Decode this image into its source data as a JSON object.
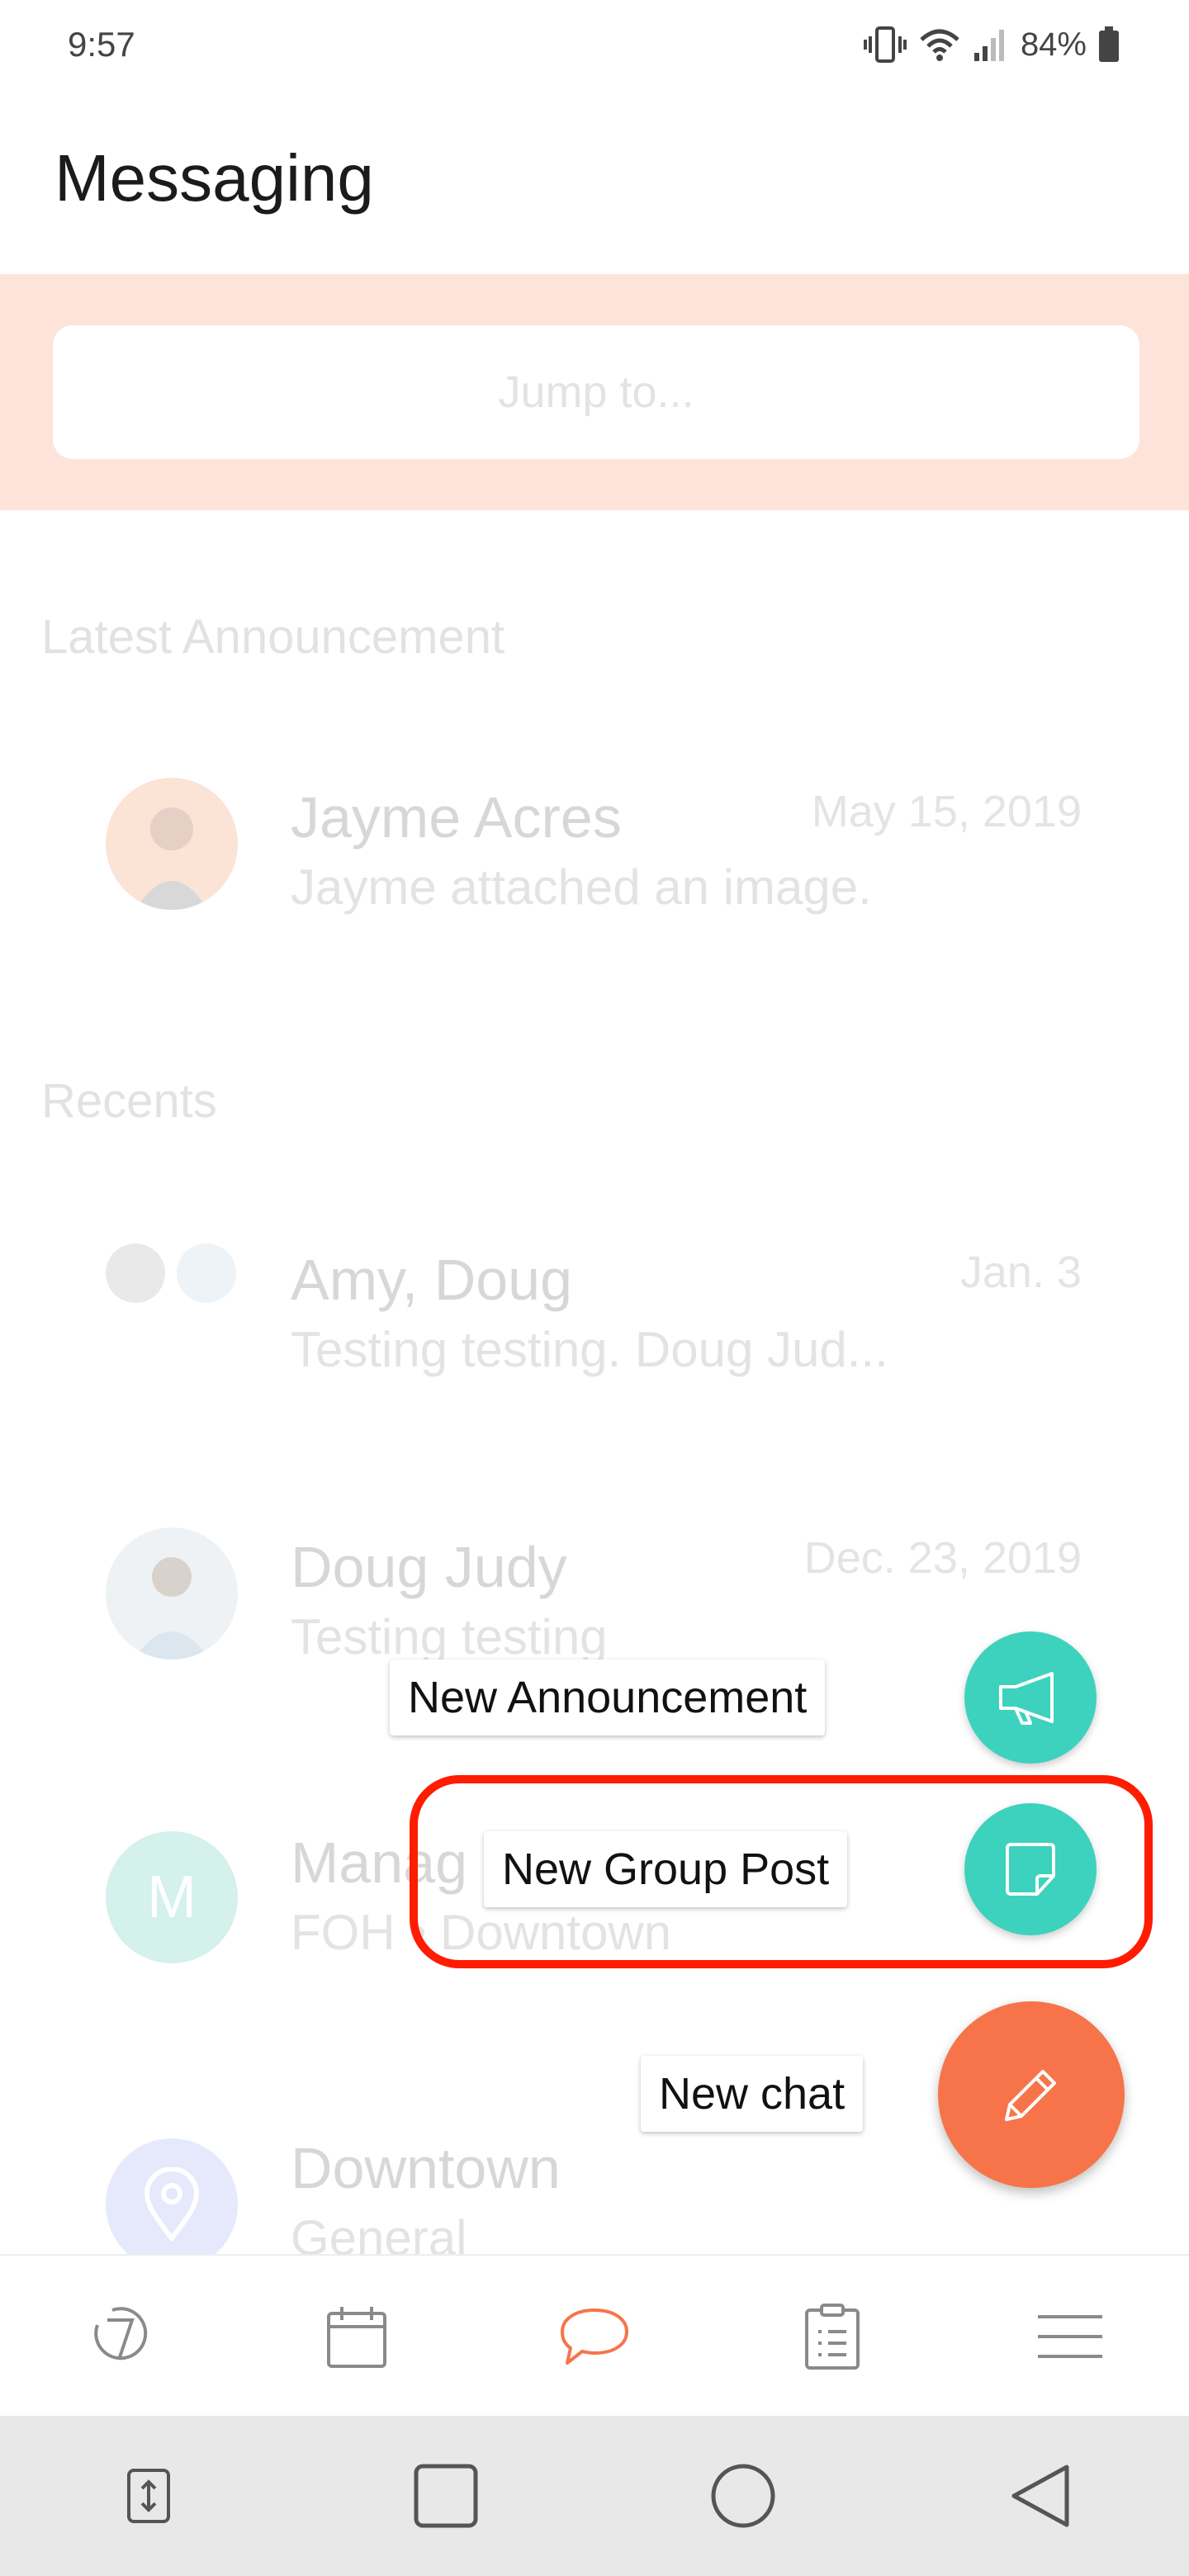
{
  "status_bar": {
    "time": "9:57",
    "battery": "84%"
  },
  "header": {
    "title": "Messaging"
  },
  "search": {
    "placeholder": "Jump to..."
  },
  "latest_announcement": {
    "label": "Latest Announcement",
    "item": {
      "name": "Jayme Acres",
      "message": "Jayme attached an image.",
      "date": "May 15, 2019"
    }
  },
  "recents": {
    "label": "Recents",
    "items": [
      {
        "name": "Amy, Doug",
        "message": "Testing testing.   Doug Jud...",
        "date": "Jan. 3"
      },
      {
        "name": "Doug Judy",
        "message": "Testing testing",
        "date": "Dec. 23, 2019"
      },
      {
        "name": "Manag",
        "message": "FOH  •  Downtown",
        "date": "",
        "avatar_letter": "M"
      },
      {
        "name": "Downtown",
        "message": "General",
        "date": ""
      }
    ]
  },
  "fab_menu": {
    "announcement_label": "New Announcement",
    "group_post_label": "New Group Post",
    "chat_label": "New chat"
  },
  "colors": {
    "accent": "#f7744a",
    "teal": "#3dd2bd",
    "highlight": "#ff1c00"
  },
  "bottom_nav": [
    "timer-icon",
    "calendar-icon",
    "chat-bubble-icon",
    "clipboard-icon",
    "menu-icon"
  ],
  "system_nav": [
    "rotate-icon",
    "recents-square-icon",
    "home-circle-icon",
    "back-triangle-icon"
  ]
}
